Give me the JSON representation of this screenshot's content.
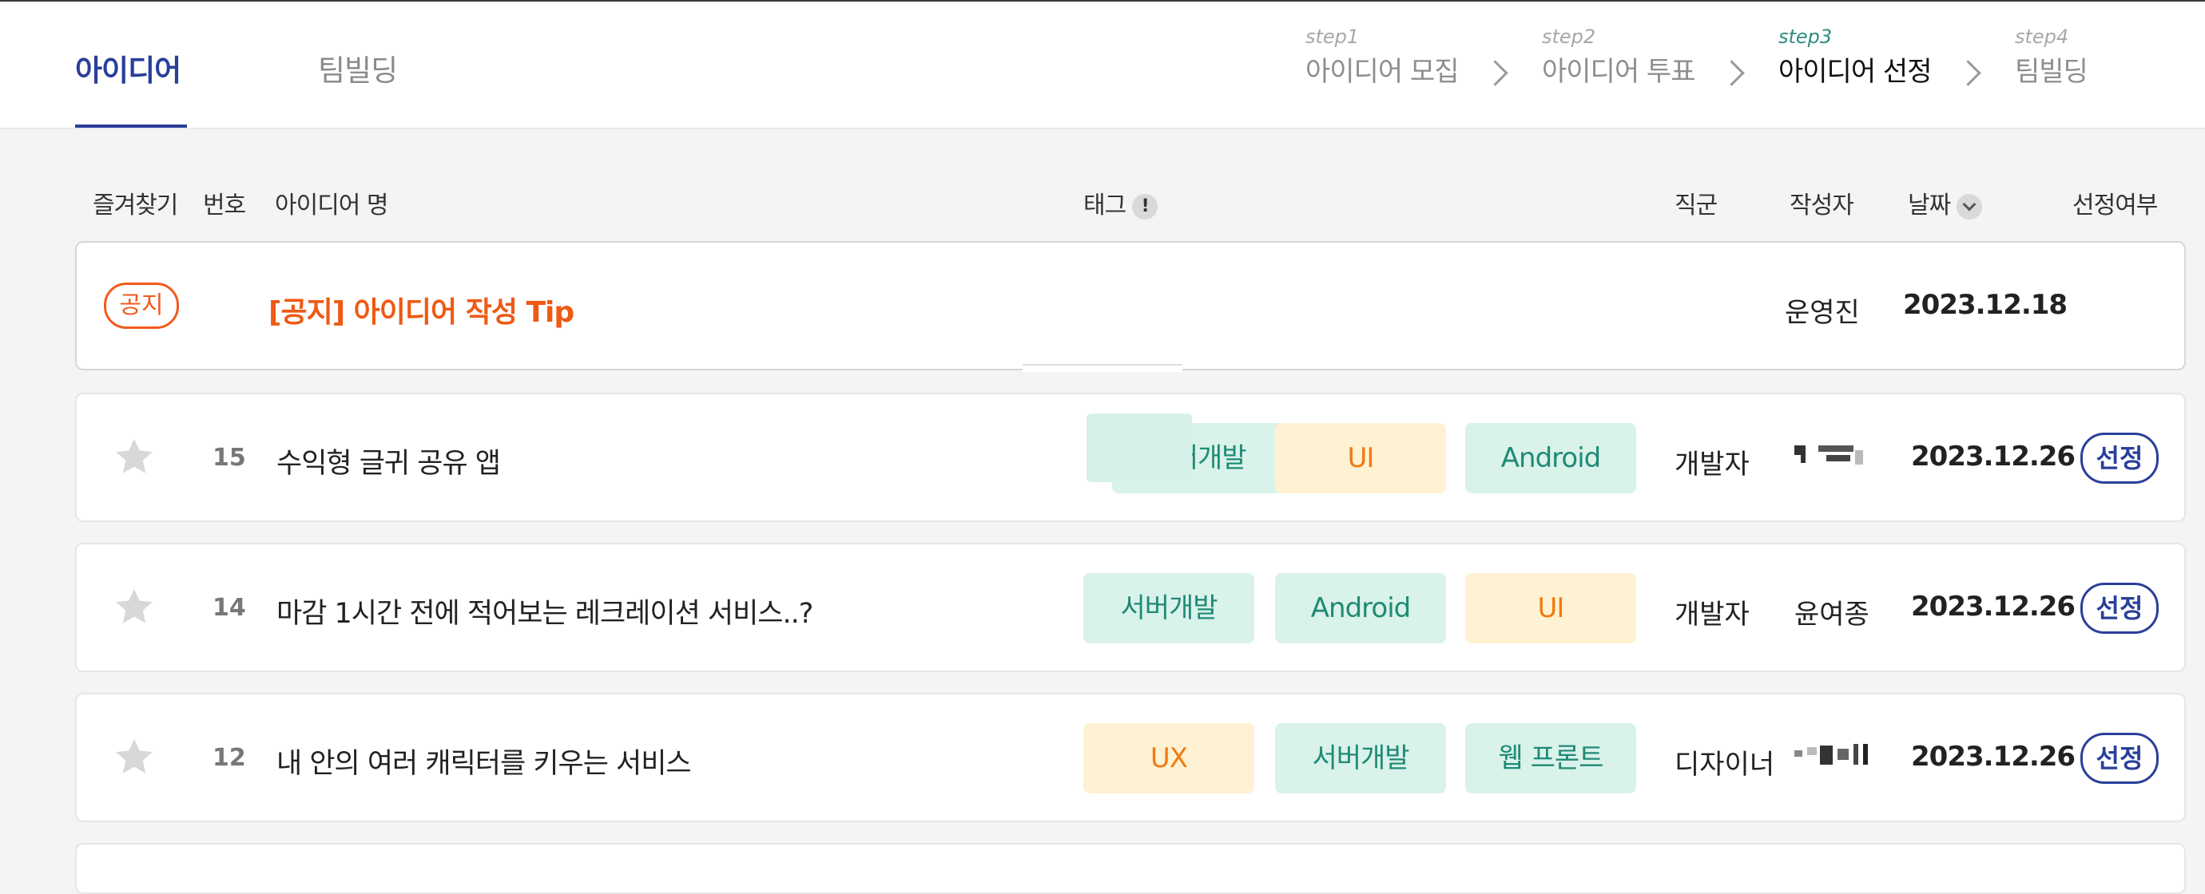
{
  "tabs": [
    {
      "label": "아이디어",
      "active": true
    },
    {
      "label": "팀빌딩",
      "active": false
    }
  ],
  "steps": [
    {
      "num": "step1",
      "label": "아이디어 모집"
    },
    {
      "num": "step2",
      "label": "아이디어 투표"
    },
    {
      "num": "step3",
      "label": "아이디어 선정",
      "current": true
    },
    {
      "num": "step4",
      "label": "팀빌딩"
    }
  ],
  "columns": {
    "favorite": "즐겨찾기",
    "number": "번호",
    "title": "아이디어 명",
    "tag": "태그",
    "tag_info": "!",
    "job": "직군",
    "author": "작성자",
    "date": "날짜",
    "selected": "선정여부"
  },
  "notice": {
    "badge": "공지",
    "title": "[공지] 아이디어 작성 Tip",
    "author": "운영진",
    "date": "2023.12.18"
  },
  "rows": [
    {
      "number": "15",
      "title": "수익형 글귀 공유 앱",
      "tags": [
        "서버개발",
        "UI",
        "Android"
      ],
      "job": "개발자",
      "author": "",
      "date": "2023.12.26",
      "select_label": "선정"
    },
    {
      "number": "14",
      "title": "마감 1시간 전에 적어보는 레크레이션 서비스..?",
      "tags": [
        "서버개발",
        "Android",
        "UI"
      ],
      "job": "개발자",
      "author": "윤여종",
      "date": "2023.12.26",
      "select_label": "선정"
    },
    {
      "number": "12",
      "title": "내 안의 여러 캐릭터를 키우는 서비스",
      "tags": [
        "UX",
        "서버개발",
        "웹 프론트"
      ],
      "job": "디자이너",
      "author": "",
      "date": "2023.12.26",
      "select_label": "선정"
    }
  ],
  "colors": {
    "brand": "#2a3f9a",
    "notice": "#f25a1c",
    "chip_green_bg": "#d9f2ea",
    "chip_green_text": "#1f8a76",
    "chip_yellow_bg": "#fff2d2",
    "chip_yellow_text": "#f27a12"
  }
}
